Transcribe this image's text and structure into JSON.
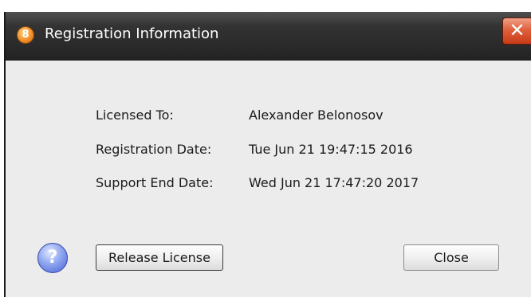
{
  "window": {
    "title": "Registration Information",
    "app_icon_glyph": "8",
    "close_glyph": "✕"
  },
  "info": {
    "licensed_to_label": "Licensed To:",
    "licensed_to_value": "Alexander Belonosov",
    "registration_date_label": "Registration Date:",
    "registration_date_value": "Tue Jun 21 19:47:15 2016",
    "support_end_label": "Support End Date:",
    "support_end_value": "Wed Jun 21 17:47:20 2017"
  },
  "help": {
    "glyph": "?"
  },
  "buttons": {
    "release_label": "Release License",
    "close_label": "Close"
  },
  "colors": {
    "titlebar": "#2a2a2a",
    "dialog_background": "#ececec",
    "close_button": "#d9502d",
    "help_icon": "#5a72e0"
  }
}
